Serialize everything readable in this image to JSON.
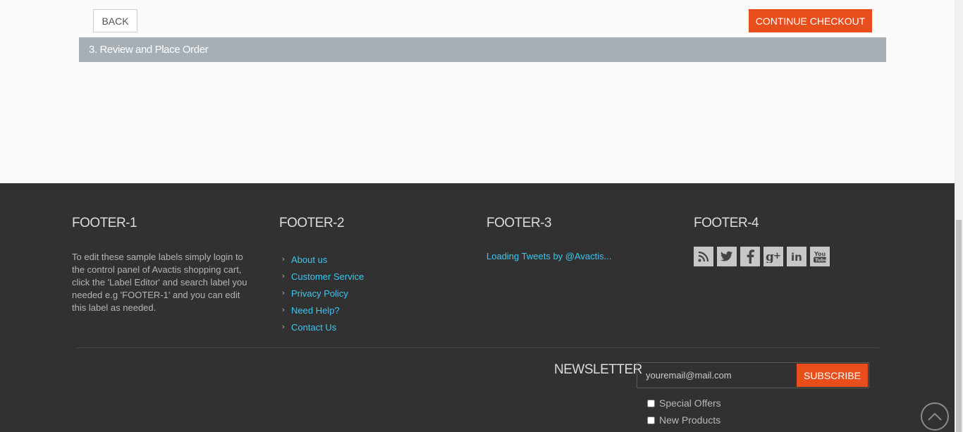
{
  "checkout": {
    "back_label": "BACK",
    "continue_label": "CONTINUE CHECKOUT",
    "step_label": "3. Review and Place Order"
  },
  "footer": {
    "col1": {
      "title": "FOOTER-1",
      "text": "To edit these sample labels simply login to the control panel of Avactis shopping cart, click the 'Label Editor' and search label you needed e.g 'FOOTER-1' and you can edit this label as needed."
    },
    "col2": {
      "title": "FOOTER-2",
      "links": [
        "About us",
        "Customer Service",
        "Privacy Policy",
        "Need Help?",
        "Contact Us"
      ]
    },
    "col3": {
      "title": "FOOTER-3",
      "tweets_text": "Loading Tweets by @Avactis..."
    },
    "col4": {
      "title": "FOOTER-4",
      "social_icons": [
        "rss-icon",
        "twitter-icon",
        "facebook-icon",
        "google-plus-icon",
        "linkedin-icon",
        "youtube-icon"
      ]
    },
    "newsletter": {
      "title": "NEWSLETTER",
      "email_value": "youremail@mail.com",
      "subscribe_label": "SUBSCRIBE",
      "options": [
        "Special Offers",
        "New Products"
      ]
    }
  },
  "colors": {
    "accent": "#e84d1c",
    "link": "#3fc5ef",
    "footer_bg": "#313131",
    "step_bar": "#a6aeb6"
  }
}
